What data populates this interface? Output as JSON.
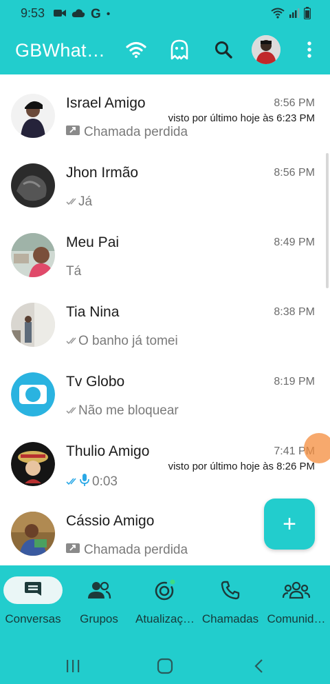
{
  "status_bar": {
    "time": "9:53",
    "g_label": "G",
    "dot": "•"
  },
  "app_bar": {
    "title": "GBWhat…"
  },
  "chats": [
    {
      "name": "Israel Amigo",
      "time": "8:56 PM",
      "last_seen": "visto por último hoje às 6:23 PM",
      "preview": "Chamada perdida",
      "preview_icon": "missed-call-icon"
    },
    {
      "name": "Jhon Irmão",
      "time": "8:56 PM",
      "last_seen": "",
      "preview": "Já",
      "preview_icon": "double-check-icon"
    },
    {
      "name": "Meu Pai",
      "time": "8:49 PM",
      "last_seen": "",
      "preview": "Tá",
      "preview_icon": ""
    },
    {
      "name": "Tia Nina",
      "time": "8:38 PM",
      "last_seen": "",
      "preview": "O banho já tomei",
      "preview_icon": "double-check-icon"
    },
    {
      "name": "Tv Globo",
      "time": "8:19 PM",
      "last_seen": "",
      "preview": "Não me bloquear",
      "preview_icon": "double-check-icon"
    },
    {
      "name": "Thulio Amigo",
      "time": "7:41 PM",
      "last_seen": "visto por último hoje às 8:26 PM",
      "preview": "0:03",
      "preview_icon": "double-check-mic-icon"
    },
    {
      "name": "Cássio Amigo",
      "time": "",
      "last_seen": "",
      "preview": "Chamada perdida",
      "preview_icon": "missed-call-icon"
    }
  ],
  "fab": {
    "label": "+"
  },
  "bottom_nav": [
    {
      "label": "Conversas",
      "icon": "chat-icon",
      "active": true
    },
    {
      "label": "Grupos",
      "icon": "groups-icon",
      "active": false
    },
    {
      "label": "Atualizaç…",
      "icon": "updates-icon",
      "active": false
    },
    {
      "label": "Chamadas",
      "icon": "phone-icon",
      "active": false
    },
    {
      "label": "Comunid…",
      "icon": "communities-icon",
      "active": false
    }
  ],
  "colors": {
    "accent": "#22cdcd",
    "read_tick": "#2aa8e6",
    "muted_tick": "#9a9a9a"
  }
}
